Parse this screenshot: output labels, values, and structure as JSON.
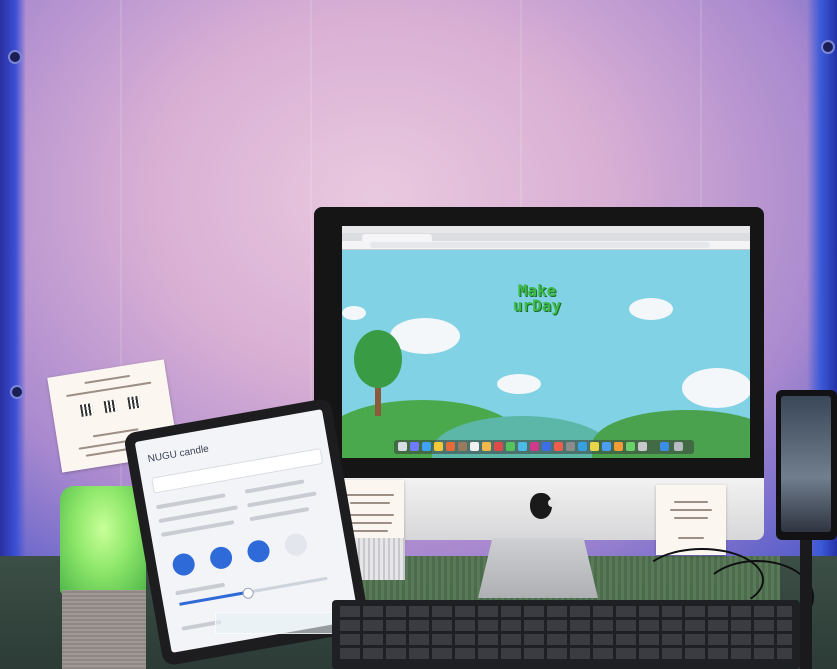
{
  "scene": {
    "screen_app": {
      "title_line1": "Make",
      "title_line2": "urDay"
    },
    "tablet_app": {
      "header": "NUGU candle"
    }
  },
  "colors": {
    "backdrop": "#d9b0d4",
    "rim_light": "#3b4fd6",
    "sky": "#80d2e4",
    "title_green": "#3dbb4a",
    "speaker_glow": "#8fe86a",
    "accent_blue": "#2f6bd8"
  },
  "tablet_slider": {
    "fraction": 0.45
  }
}
